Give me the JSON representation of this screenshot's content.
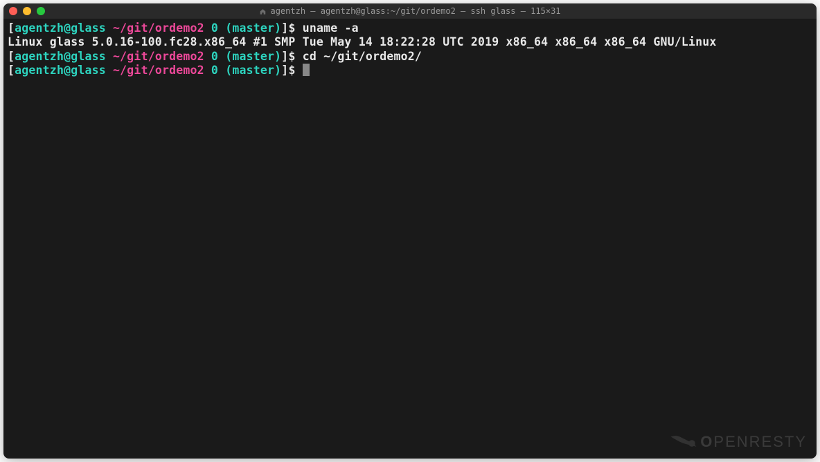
{
  "window": {
    "title": "agentzh — agentzh@glass:~/git/ordemo2 — ssh glass — 115×31"
  },
  "lines": [
    {
      "prompt": {
        "open": "[",
        "user": "agentzh@glass",
        "path": "~/git/ordemo2",
        "status": "0",
        "branch_open": "(",
        "branch": "master",
        "branch_close": ")",
        "close": "]",
        "dollar": "$"
      },
      "command": "uname -a"
    },
    {
      "output": "Linux glass 5.0.16-100.fc28.x86_64 #1 SMP Tue May 14 18:22:28 UTC 2019 x86_64 x86_64 x86_64 GNU/Linux"
    },
    {
      "prompt": {
        "open": "[",
        "user": "agentzh@glass",
        "path": "~/git/ordemo2",
        "status": "0",
        "branch_open": "(",
        "branch": "master",
        "branch_close": ")",
        "close": "]",
        "dollar": "$"
      },
      "command": "cd ~/git/ordemo2/"
    },
    {
      "prompt": {
        "open": "[",
        "user": "agentzh@glass",
        "path": "~/git/ordemo2",
        "status": "0",
        "branch_open": "(",
        "branch": "master",
        "branch_close": ")",
        "close": "]",
        "dollar": "$"
      },
      "cursor": true
    }
  ],
  "watermark": {
    "text": "PENRESTY"
  }
}
